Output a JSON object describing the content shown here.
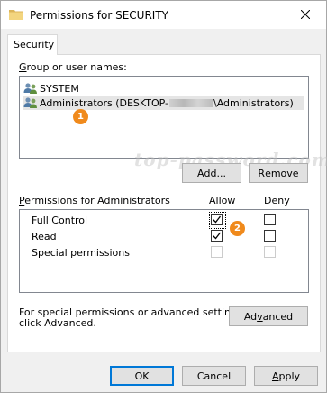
{
  "window": {
    "title": "Permissions for SECURITY"
  },
  "tabs": [
    {
      "label": "Security"
    }
  ],
  "group": {
    "label_prefix": "",
    "label_mnemonic": "G",
    "label_rest": "roup or user names:",
    "items": [
      {
        "name": "SYSTEM",
        "icon": "users-icon"
      },
      {
        "name_before": "Administrators (DESKTOP-",
        "name_after": "\\Administrators)",
        "icon": "users-icon",
        "selected": true
      }
    ]
  },
  "buttons": {
    "add_mnemonic": "A",
    "add_rest": "dd...",
    "remove_mnemonic": "R",
    "remove_rest": "emove",
    "advanced_pre": "Ad",
    "advanced_mnemonic": "v",
    "advanced_rest": "anced",
    "ok": "OK",
    "cancel": "Cancel",
    "apply_mnemonic": "A",
    "apply_rest": "pply"
  },
  "permissions": {
    "label_mnemonic": "P",
    "label_rest": "ermissions for Administrators",
    "allow_header": "Allow",
    "deny_header": "Deny",
    "rows": [
      {
        "name": "Full Control",
        "allow": true,
        "deny": false,
        "enabled": true
      },
      {
        "name": "Read",
        "allow": true,
        "deny": false,
        "enabled": true
      },
      {
        "name": "Special permissions",
        "allow": false,
        "deny": false,
        "enabled": false
      }
    ]
  },
  "advanced_text": {
    "line1": "For special permissions or advanced settings,",
    "line2": "click Advanced."
  },
  "watermark": "top-password.com",
  "badges": [
    "1",
    "2"
  ],
  "colors": {
    "badge": "#f08a1c",
    "default_button_border": "#0078d7",
    "selection": "#e5e5e5"
  }
}
